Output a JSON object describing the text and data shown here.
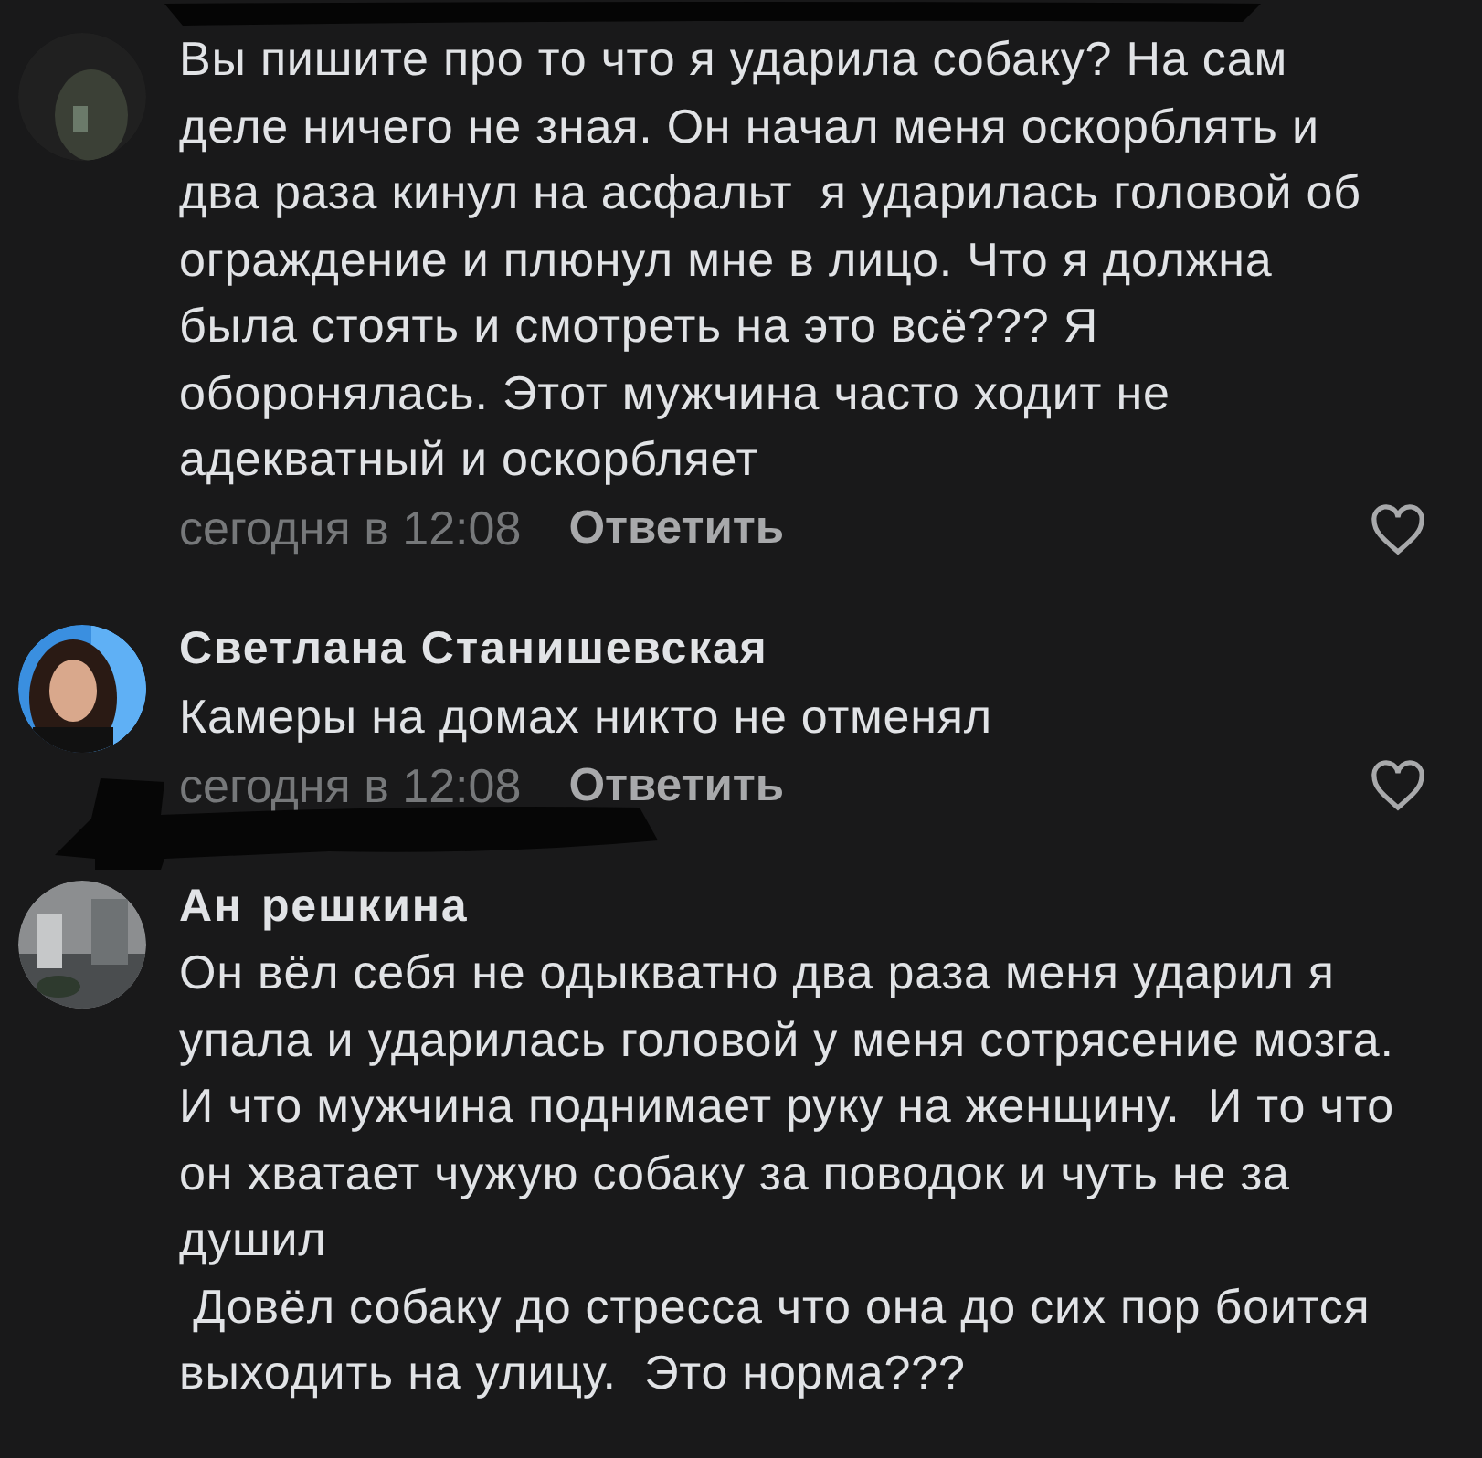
{
  "comments": [
    {
      "avatar": {
        "kind": "picture"
      },
      "text": "Вы пишите про то что я ударила собаку? На сам деле ничего не зная. Он начал меня оскорблять и два раза кинул на асфальт  я ударилась головой об ограждение и плюнул мне в лицо. Что я должна была стоять и смотреть на это всё??? Я оборонялась. Этот мужчина часто ходит не адекватный и оскорбляет",
      "time": "сегодня в 12:08",
      "reply": "Ответить",
      "liked": false,
      "redacted": true
    },
    {
      "author_parts": [
        "Светлана Станишевская"
      ],
      "avatar": {
        "kind": "picture"
      },
      "text": "Камеры на домах никто не отменял",
      "time": "сегодня в 12:08",
      "reply": "Ответить",
      "liked": false
    },
    {
      "author_parts": [
        "Ан",
        "решкина"
      ],
      "avatar": {
        "kind": "picture"
      },
      "text": "Он вёл себя не одыкватно два раза меня ударил я упала и ударилась головой у меня сотрясение мозга. И что мужчина поднимает руку на женщину.  И то что он хватает чужую собаку за поводок и чуть не за душил\n Довёл собаку до стресса что она до сих пор боится выходить на улицу.  Это норма???",
      "redacted": true
    }
  ]
}
